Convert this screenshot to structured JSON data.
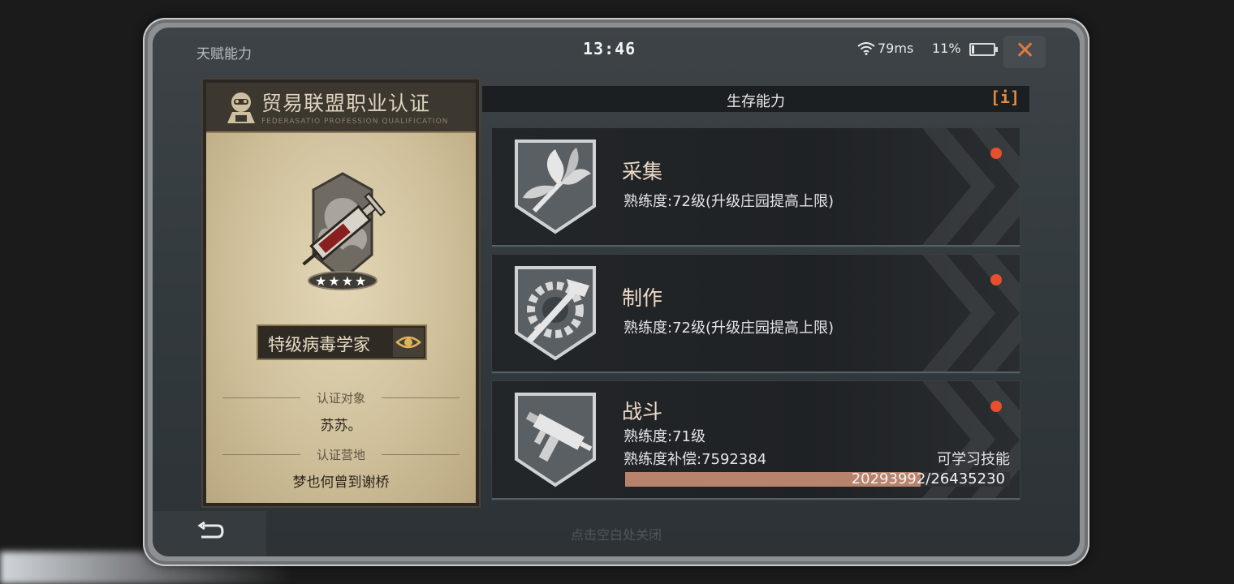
{
  "status_bar": {
    "title": "天赋能力",
    "time": "13:46",
    "ping": "79ms",
    "battery": "11%"
  },
  "certificate": {
    "title": "贸易联盟职业认证",
    "subtitle": "FEDERASATIO PROFESSION QUALIFICATION",
    "job_title": "特级病毒学家",
    "target_label": "认证对象",
    "target_value": "苏苏。",
    "camp_label": "认证营地",
    "camp_value": "梦也何曾到谢桥",
    "stars": 4
  },
  "panel": {
    "title": "生存能力",
    "info_label": "[i]",
    "skills": [
      {
        "name": "采集",
        "proficiency": "熟练度:72级(升级庄园提高上限)",
        "icon": "herb-icon"
      },
      {
        "name": "制作",
        "proficiency": "熟练度:72级(升级庄园提高上限)",
        "icon": "gear-hammer-icon"
      },
      {
        "name": "战斗",
        "proficiency": "熟练度:71级",
        "compensation": "熟练度补偿:7592384",
        "learnable": "可学习技能",
        "progress_text": "20293992/26435230",
        "progress": 0.7677,
        "icon": "smg-icon"
      }
    ]
  },
  "footer": {
    "hint": "点击空白处关闭"
  },
  "colors": {
    "accent": "#e08b42",
    "alert": "#e8502d",
    "progress": "#b8836d"
  }
}
